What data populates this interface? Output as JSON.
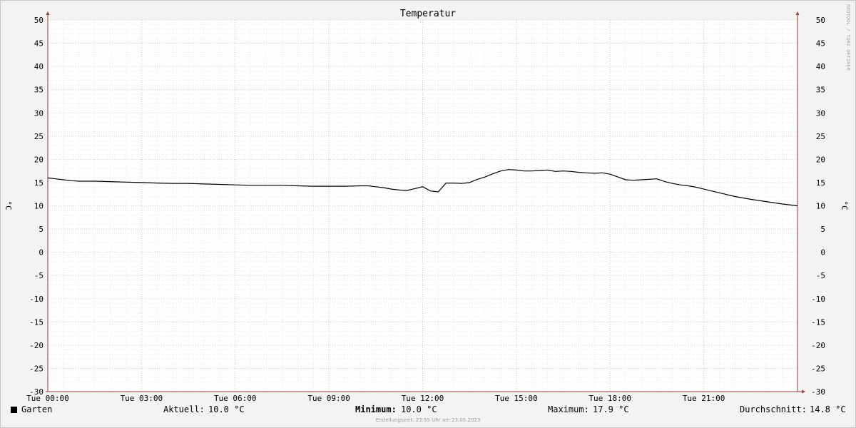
{
  "chart_data": {
    "type": "line",
    "title": "Temperatur",
    "ylabel_left": "°C",
    "ylabel_right": "°C",
    "watermark": "RRDTOOL / TOBI OETIKER",
    "ylim": [
      -30,
      50
    ],
    "y_ticks": [
      50,
      45,
      40,
      35,
      30,
      25,
      20,
      15,
      10,
      5,
      0,
      -5,
      -10,
      -15,
      -20,
      -25,
      -30
    ],
    "x_range_hours": [
      0,
      24
    ],
    "x_tick_hours": [
      0,
      3,
      6,
      9,
      12,
      15,
      18,
      21
    ],
    "x_tick_labels": [
      "Tue 00:00",
      "Tue 03:00",
      "Tue 06:00",
      "Tue 09:00",
      "Tue 12:00",
      "Tue 15:00",
      "Tue 18:00",
      "Tue 21:00"
    ],
    "grid": true,
    "series": [
      {
        "name": "Garten",
        "color": "#000000",
        "x_hours": [
          0,
          0.25,
          0.5,
          0.75,
          1,
          1.5,
          2,
          2.5,
          3,
          3.5,
          4,
          4.5,
          5,
          5.5,
          6,
          6.5,
          7,
          7.5,
          8,
          8.5,
          9,
          9.5,
          10,
          10.25,
          10.5,
          10.75,
          11,
          11.25,
          11.5,
          11.75,
          12,
          12.25,
          12.5,
          12.75,
          13,
          13.25,
          13.5,
          13.75,
          14,
          14.25,
          14.5,
          14.75,
          15,
          15.25,
          15.5,
          15.75,
          16,
          16.25,
          16.5,
          16.75,
          17,
          17.25,
          17.5,
          17.75,
          18,
          18.25,
          18.5,
          18.75,
          19,
          19.25,
          19.5,
          19.75,
          20,
          20.25,
          20.5,
          20.75,
          21,
          21.5,
          22,
          22.5,
          23,
          23.5,
          24
        ],
        "y_values": [
          16.0,
          15.8,
          15.6,
          15.4,
          15.3,
          15.3,
          15.2,
          15.1,
          15.0,
          14.9,
          14.8,
          14.8,
          14.7,
          14.6,
          14.5,
          14.4,
          14.4,
          14.4,
          14.3,
          14.2,
          14.2,
          14.2,
          14.3,
          14.3,
          14.1,
          13.9,
          13.6,
          13.4,
          13.3,
          13.7,
          14.1,
          13.2,
          13.0,
          14.9,
          14.9,
          14.8,
          15.0,
          15.7,
          16.2,
          16.9,
          17.5,
          17.8,
          17.7,
          17.5,
          17.5,
          17.6,
          17.7,
          17.4,
          17.5,
          17.4,
          17.2,
          17.1,
          17.0,
          17.1,
          16.8,
          16.2,
          15.6,
          15.5,
          15.6,
          15.7,
          15.8,
          15.2,
          14.8,
          14.5,
          14.3,
          14.0,
          13.6,
          12.8,
          12.0,
          11.4,
          10.9,
          10.4,
          10.0
        ]
      }
    ]
  },
  "legend": {
    "series_name": "Garten",
    "current_label": "Aktuell:",
    "current_value": "10.0 °C",
    "min_label": "Minimum:",
    "min_value": "10.0 °C",
    "max_label": "Maximum:",
    "max_value": "17.9 °C",
    "avg_label": "Durchschnitt:",
    "avg_value": "14.8 °C"
  },
  "footer": {
    "created": "Erstellungszeit: 23:55 Uhr am 23.05.2023"
  }
}
